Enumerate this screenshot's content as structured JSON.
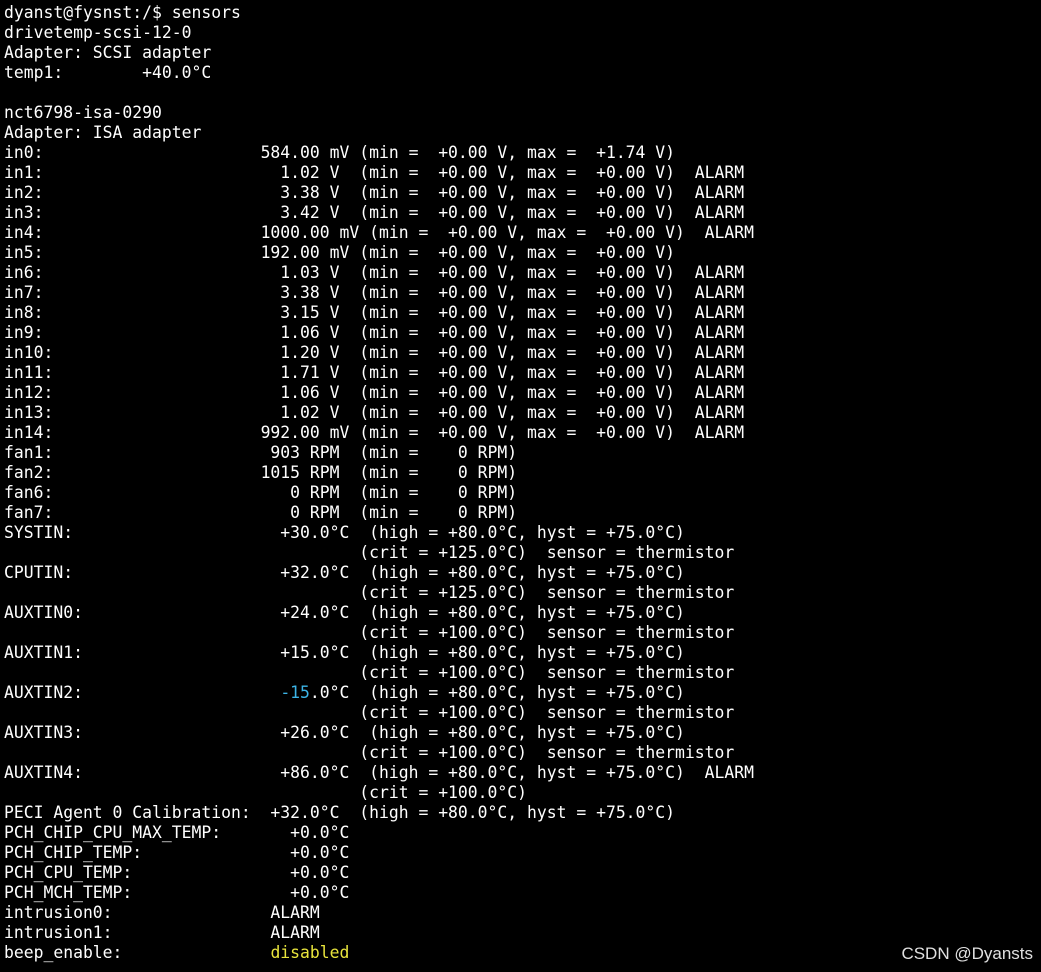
{
  "colors": {
    "background": "#000000",
    "text": "#ffffff",
    "negative_value": "#3cb4e6",
    "disabled_value": "#e8e43c",
    "watermark": "#e0e0e0"
  },
  "terminal": {
    "lines": [
      [
        {
          "text": "dyanst@fysnst:/$ sensors"
        }
      ],
      [
        {
          "text": "drivetemp-scsi-12-0"
        }
      ],
      [
        {
          "text": "Adapter: SCSI adapter"
        }
      ],
      [
        {
          "text": "temp1:        +40.0°C"
        }
      ],
      [
        {
          "text": ""
        }
      ],
      [
        {
          "text": "nct6798-isa-0290"
        }
      ],
      [
        {
          "text": "Adapter: ISA adapter"
        }
      ],
      [
        {
          "text": "in0:                      584.00 mV (min =  +0.00 V, max =  +1.74 V)"
        }
      ],
      [
        {
          "text": "in1:                        1.02 V  (min =  +0.00 V, max =  +0.00 V)  ALARM"
        }
      ],
      [
        {
          "text": "in2:                        3.38 V  (min =  +0.00 V, max =  +0.00 V)  ALARM"
        }
      ],
      [
        {
          "text": "in3:                        3.42 V  (min =  +0.00 V, max =  +0.00 V)  ALARM"
        }
      ],
      [
        {
          "text": "in4:                      1000.00 mV (min =  +0.00 V, max =  +0.00 V)  ALARM"
        }
      ],
      [
        {
          "text": "in5:                      192.00 mV (min =  +0.00 V, max =  +0.00 V)"
        }
      ],
      [
        {
          "text": "in6:                        1.03 V  (min =  +0.00 V, max =  +0.00 V)  ALARM"
        }
      ],
      [
        {
          "text": "in7:                        3.38 V  (min =  +0.00 V, max =  +0.00 V)  ALARM"
        }
      ],
      [
        {
          "text": "in8:                        3.15 V  (min =  +0.00 V, max =  +0.00 V)  ALARM"
        }
      ],
      [
        {
          "text": "in9:                        1.06 V  (min =  +0.00 V, max =  +0.00 V)  ALARM"
        }
      ],
      [
        {
          "text": "in10:                       1.20 V  (min =  +0.00 V, max =  +0.00 V)  ALARM"
        }
      ],
      [
        {
          "text": "in11:                       1.71 V  (min =  +0.00 V, max =  +0.00 V)  ALARM"
        }
      ],
      [
        {
          "text": "in12:                       1.06 V  (min =  +0.00 V, max =  +0.00 V)  ALARM"
        }
      ],
      [
        {
          "text": "in13:                       1.02 V  (min =  +0.00 V, max =  +0.00 V)  ALARM"
        }
      ],
      [
        {
          "text": "in14:                     992.00 mV (min =  +0.00 V, max =  +0.00 V)  ALARM"
        }
      ],
      [
        {
          "text": "fan1:                      903 RPM  (min =    0 RPM)"
        }
      ],
      [
        {
          "text": "fan2:                     1015 RPM  (min =    0 RPM)"
        }
      ],
      [
        {
          "text": "fan6:                        0 RPM  (min =    0 RPM)"
        }
      ],
      [
        {
          "text": "fan7:                        0 RPM  (min =    0 RPM)"
        }
      ],
      [
        {
          "text": "SYSTIN:                     +30.0°C  (high = +80.0°C, hyst = +75.0°C)"
        }
      ],
      [
        {
          "text": "                                    (crit = +125.0°C)  sensor = thermistor"
        }
      ],
      [
        {
          "text": "CPUTIN:                     +32.0°C  (high = +80.0°C, hyst = +75.0°C)"
        }
      ],
      [
        {
          "text": "                                    (crit = +125.0°C)  sensor = thermistor"
        }
      ],
      [
        {
          "text": "AUXTIN0:                    +24.0°C  (high = +80.0°C, hyst = +75.0°C)"
        }
      ],
      [
        {
          "text": "                                    (crit = +100.0°C)  sensor = thermistor"
        }
      ],
      [
        {
          "text": "AUXTIN1:                    +15.0°C  (high = +80.0°C, hyst = +75.0°C)"
        }
      ],
      [
        {
          "text": "                                    (crit = +100.0°C)  sensor = thermistor"
        }
      ],
      [
        {
          "text": "AUXTIN2:                    "
        },
        {
          "text": "-15",
          "color": "blue"
        },
        {
          "text": ".0°C  (high = +80.0°C, hyst = +75.0°C)"
        }
      ],
      [
        {
          "text": "                                    (crit = +100.0°C)  sensor = thermistor"
        }
      ],
      [
        {
          "text": "AUXTIN3:                    +26.0°C  (high = +80.0°C, hyst = +75.0°C)"
        }
      ],
      [
        {
          "text": "                                    (crit = +100.0°C)  sensor = thermistor"
        }
      ],
      [
        {
          "text": "AUXTIN4:                    +86.0°C  (high = +80.0°C, hyst = +75.0°C)  ALARM"
        }
      ],
      [
        {
          "text": "                                    (crit = +100.0°C)"
        }
      ],
      [
        {
          "text": "PECI Agent 0 Calibration:  +32.0°C  (high = +80.0°C, hyst = +75.0°C)"
        }
      ],
      [
        {
          "text": "PCH_CHIP_CPU_MAX_TEMP:       +0.0°C"
        }
      ],
      [
        {
          "text": "PCH_CHIP_TEMP:               +0.0°C"
        }
      ],
      [
        {
          "text": "PCH_CPU_TEMP:                +0.0°C"
        }
      ],
      [
        {
          "text": "PCH_MCH_TEMP:                +0.0°C"
        }
      ],
      [
        {
          "text": "intrusion0:                ALARM"
        }
      ],
      [
        {
          "text": "intrusion1:                ALARM"
        }
      ],
      [
        {
          "text": "beep_enable:               "
        },
        {
          "text": "disabled",
          "color": "yellow"
        }
      ]
    ]
  },
  "watermark": "CSDN @Dyansts"
}
